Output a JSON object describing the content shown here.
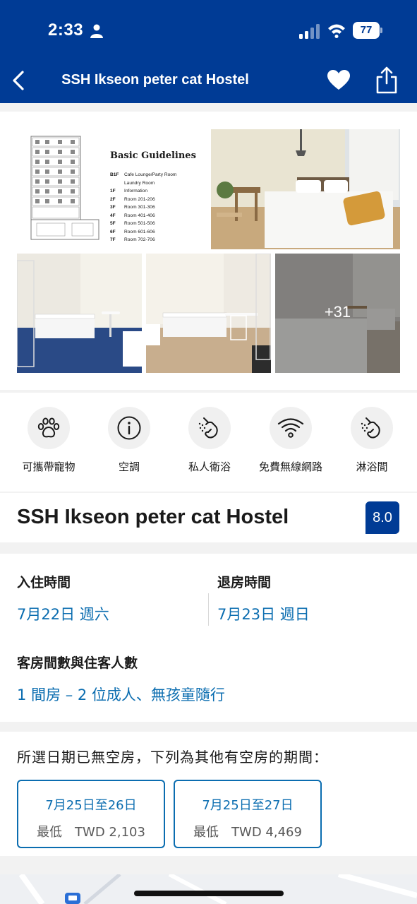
{
  "status": {
    "time": "2:33",
    "battery": "77"
  },
  "nav": {
    "title": "SSH Ikseon peter cat Hostel"
  },
  "gallery": {
    "guidelines_title": "Basic Guidelines",
    "floors": [
      {
        "floor": "B1F",
        "text": "Cafe Lounge/Party Room"
      },
      {
        "floor": "",
        "text": "Laundry Room"
      },
      {
        "floor": "1F",
        "text": "Information"
      },
      {
        "floor": "2F",
        "text": "Room 201-206"
      },
      {
        "floor": "3F",
        "text": "Room 301-306"
      },
      {
        "floor": "4F",
        "text": "Room 401-406"
      },
      {
        "floor": "5F",
        "text": "Room 501-506"
      },
      {
        "floor": "6F",
        "text": "Room 601-606"
      },
      {
        "floor": "7F",
        "text": "Room 702-706"
      }
    ],
    "more_photos": "+31"
  },
  "facilities": [
    {
      "label": "可攜帶寵物",
      "icon": "paw-icon"
    },
    {
      "label": "空調",
      "icon": "info-icon"
    },
    {
      "label": "私人衛浴",
      "icon": "shower-icon"
    },
    {
      "label": "免費無線網路",
      "icon": "wifi-icon"
    },
    {
      "label": "淋浴間",
      "icon": "shower-icon"
    }
  ],
  "property": {
    "name": "SSH Ikseon peter cat Hostel",
    "score": "8.0"
  },
  "booking": {
    "checkin_label": "入住時間",
    "checkin_value": "7月22日 週六",
    "checkout_label": "退房時間",
    "checkout_value": "7月23日 週日",
    "rooms_label": "客房間數與住客人數",
    "rooms_value": "1 間房 – 2 位成人、無孩童隨行"
  },
  "availability": {
    "message": "所選日期已無空房，下列為其他有空房的期間：",
    "options": [
      {
        "range": "7月25日至26日",
        "price": "最低　TWD 2,103"
      },
      {
        "range": "7月25日至27日",
        "price": "最低　TWD 4,469"
      }
    ]
  },
  "colors": {
    "brand": "#003b95",
    "link": "#0b6db0"
  }
}
